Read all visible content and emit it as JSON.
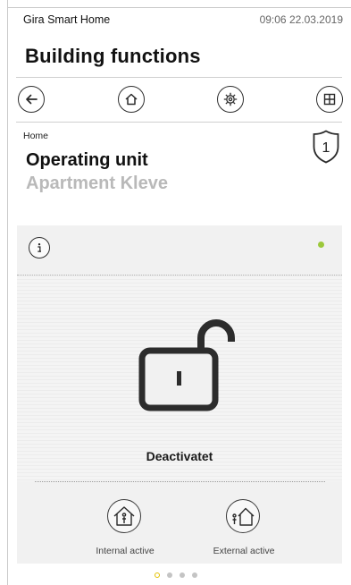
{
  "statusbar": {
    "app_name": "Gira Smart Home",
    "datetime": "09:06 22.03.2019"
  },
  "page": {
    "title": "Building functions"
  },
  "toolbar": {
    "icons": [
      "back-arrow-icon",
      "home-icon",
      "gear-icon",
      "grid-icon"
    ]
  },
  "breadcrumb": "Home",
  "unit": {
    "title": "Operating unit",
    "subtitle": "Apartment Kleve",
    "badge": "1"
  },
  "panel": {
    "info_label": "i",
    "status_led_color": "#9cc83b",
    "state": "Deactivatet",
    "modes": [
      {
        "label": "Internal active",
        "icon": "house-person-inside-icon"
      },
      {
        "label": "External active",
        "icon": "house-person-outside-icon"
      }
    ]
  },
  "pager": {
    "count": 4,
    "active_index": 0,
    "active_color": "#e4c200"
  }
}
